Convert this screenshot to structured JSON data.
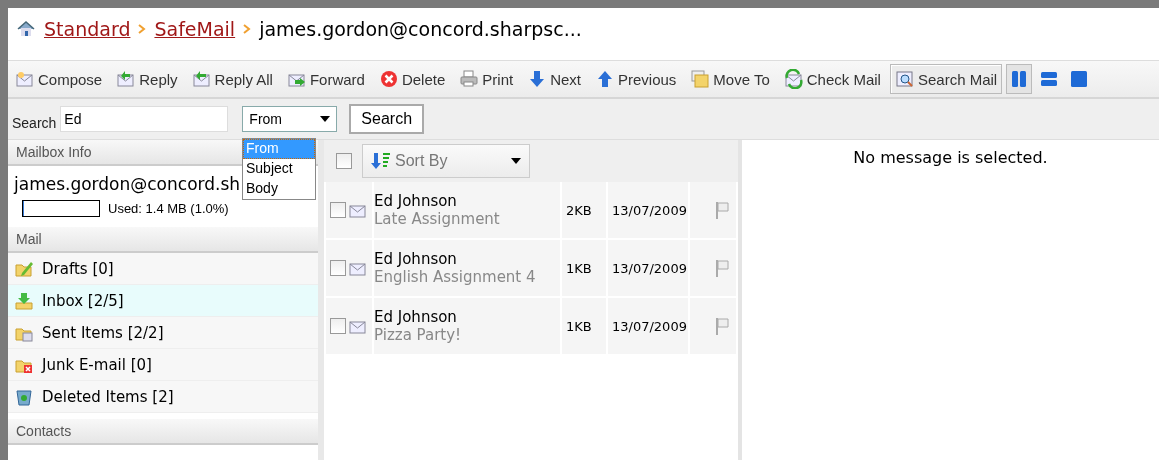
{
  "breadcrumb": [
    {
      "label": "Standard",
      "kind": "link"
    },
    {
      "label": "SafeMail",
      "kind": "link"
    },
    {
      "label": "james.gordon@concord.sharpsc...",
      "kind": "current"
    }
  ],
  "toolbar": [
    {
      "label": "Compose",
      "kind": "compose",
      "pressed": false
    },
    {
      "label": "Reply",
      "kind": "reply",
      "pressed": false
    },
    {
      "label": "Reply All",
      "kind": "reply_all",
      "pressed": false
    },
    {
      "label": "Forward",
      "kind": "forward",
      "pressed": false
    },
    {
      "label": "Delete",
      "kind": "delete",
      "pressed": false
    },
    {
      "label": "Print",
      "kind": "print",
      "pressed": false
    },
    {
      "label": "Next",
      "kind": "next",
      "pressed": false
    },
    {
      "label": "Previous",
      "kind": "previous",
      "pressed": false
    },
    {
      "label": "Move To",
      "kind": "move",
      "pressed": false
    },
    {
      "label": "Check Mail",
      "kind": "check",
      "pressed": false
    },
    {
      "label": "Search Mail",
      "kind": "search",
      "pressed": true
    }
  ],
  "view_buttons": [
    {
      "kind": "columns",
      "selected": true
    },
    {
      "kind": "rows",
      "selected": false
    },
    {
      "kind": "single",
      "selected": false
    }
  ],
  "search": {
    "label": "Search",
    "value": "Ed",
    "field": "From",
    "button": "Search",
    "options": [
      {
        "label": "From",
        "selected": true
      },
      {
        "label": "Subject",
        "selected": false
      },
      {
        "label": "Body",
        "selected": false
      }
    ]
  },
  "mailbox_info": {
    "title": "Mailbox Info",
    "account": "james.gordon@concord.sh",
    "usage": {
      "level": 0.01,
      "reading": "Used: 1.4 MB (1.0%)"
    }
  },
  "mail": {
    "title": "Mail",
    "folders": [
      {
        "label": "Drafts [0]",
        "kind": "drafts",
        "selected": false
      },
      {
        "label": "Inbox [2/5]",
        "kind": "inbox",
        "selected": true
      },
      {
        "label": "Sent Items [2/2]",
        "kind": "sent",
        "selected": false
      },
      {
        "label": "Junk E-mail [0]",
        "kind": "junk",
        "selected": false
      },
      {
        "label": "Deleted Items [2]",
        "kind": "deleted",
        "selected": false
      }
    ]
  },
  "contacts": {
    "title": "Contacts"
  },
  "list": {
    "select_all": false,
    "sort": "Sort By",
    "messages": [
      {
        "from": "Ed Johnson",
        "subject": "Late Assignment",
        "size": "2KB",
        "date": "13/07/2009",
        "checked": false,
        "flagged": false
      },
      {
        "from": "Ed Johnson",
        "subject": "English Assignment 4",
        "size": "1KB",
        "date": "13/07/2009",
        "checked": false,
        "flagged": false
      },
      {
        "from": "Ed Johnson",
        "subject": "Pizza Party!",
        "size": "1KB",
        "date": "13/07/2009",
        "checked": false,
        "flagged": false
      }
    ]
  },
  "preview": {
    "message": "No message is selected."
  }
}
